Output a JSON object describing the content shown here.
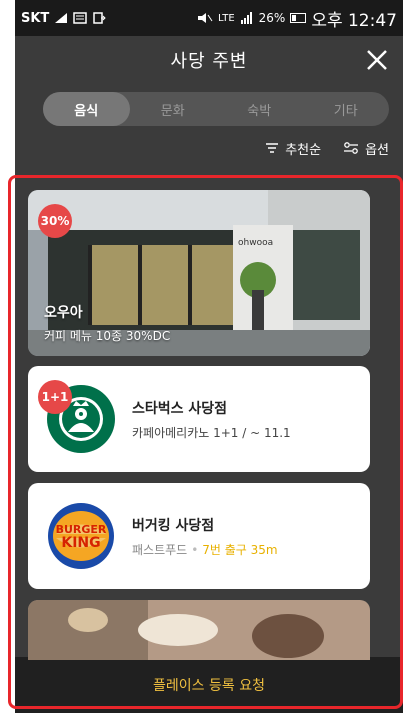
{
  "status_bar": {
    "carrier": "SKT",
    "network": "LTE",
    "battery": "26%",
    "time": "오후 12:47"
  },
  "header": {
    "title": "사당 주변"
  },
  "tabs": [
    {
      "label": "음식",
      "active": true
    },
    {
      "label": "문화",
      "active": false
    },
    {
      "label": "숙박",
      "active": false
    },
    {
      "label": "기타",
      "active": false
    }
  ],
  "sort": {
    "order_label": "추천순",
    "options_label": "옵션"
  },
  "places": [
    {
      "name": "오우아",
      "desc": "커피 메뉴 10종 30%DC",
      "badge": "30%",
      "storefront_sign": "ohwooa"
    },
    {
      "name": "스타벅스 사당점",
      "desc": "카페아메리카노 1+1 / ~ 11.1",
      "badge": "1+1",
      "logo": "starbucks-logo"
    },
    {
      "name": "버거킹 사당점",
      "category": "패스트푸드",
      "distance": "7번 출구 35m",
      "logo": "burger-king-logo",
      "logo_text_top": "BURGER",
      "logo_text_bottom": "KING"
    }
  ],
  "register_button": "플레이스 등록 요청",
  "colors": {
    "badge": "#e64848",
    "accent_yellow": "#e8b100",
    "highlight_frame": "#e8262b"
  }
}
